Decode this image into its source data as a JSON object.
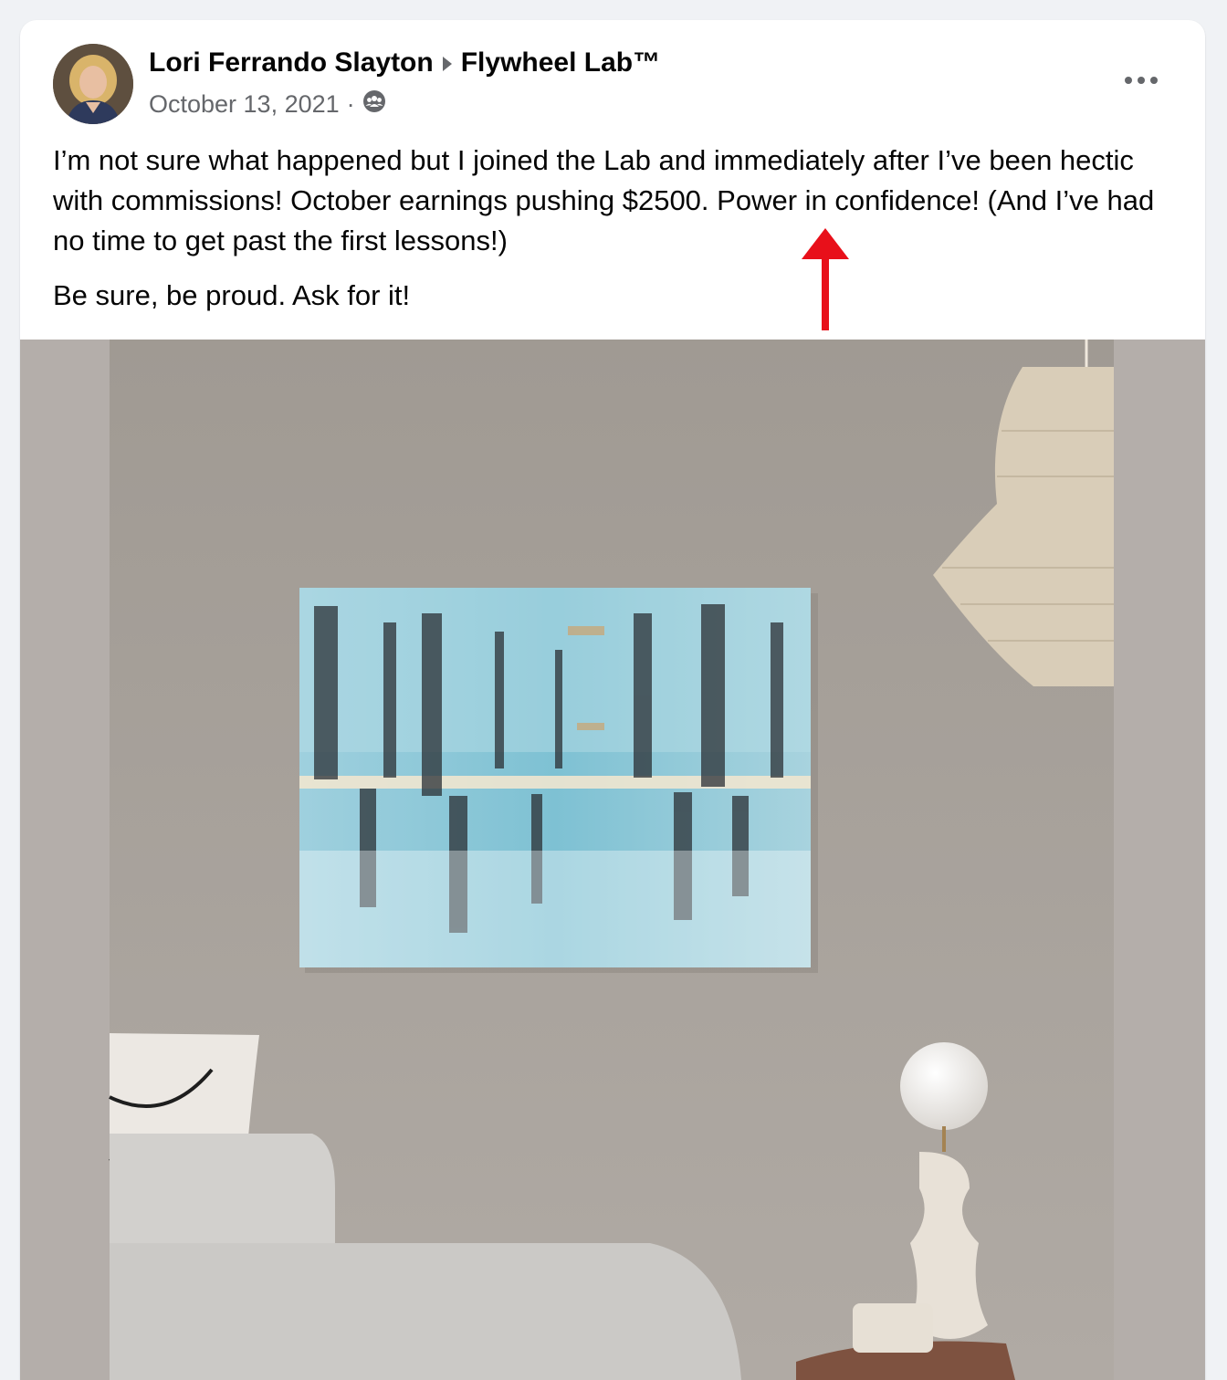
{
  "post": {
    "author": "Lori Ferrando Slayton",
    "group": "Flywheel Lab™",
    "date": "October 13, 2021",
    "separator": "·",
    "privacy_icon": "group-members-icon",
    "more_icon": "more-options-icon",
    "text_paragraph_1": "I’m not sure what happened but I joined the Lab and immediately after I’ve been hectic with commissions! October earnings pushing $2500. Power in confidence! (And I’ve had no time to get past the first lessons!)",
    "text_paragraph_2": "Be sure, be proud. Ask for it!"
  },
  "annotation": {
    "arrow_color": "#e8101a"
  },
  "colors": {
    "wall": "#ada6a0",
    "painting_blue": "#8fc6d6",
    "page_bg": "#f0f2f5"
  }
}
